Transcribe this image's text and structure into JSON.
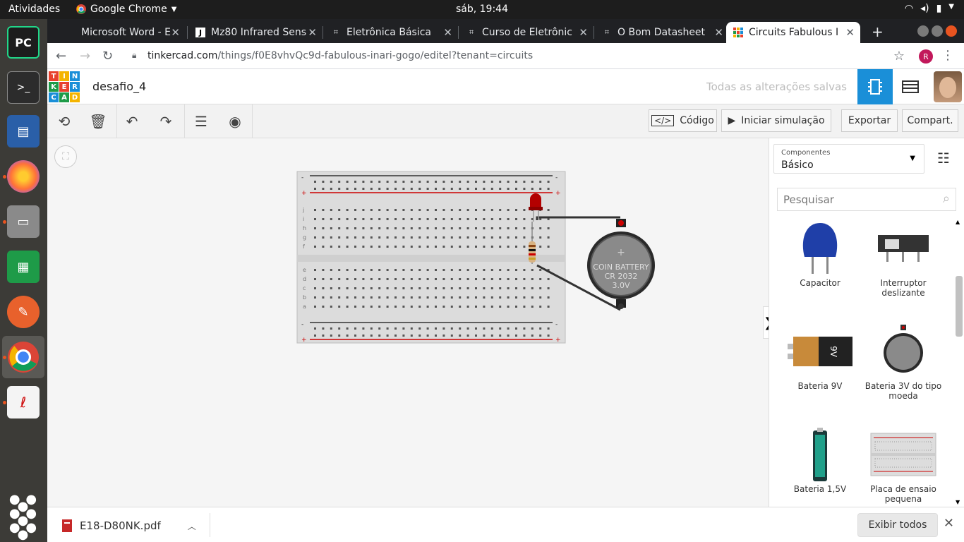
{
  "system": {
    "activities": "Atividades",
    "app_name": "Google Chrome",
    "clock": "sáb, 19:44"
  },
  "tabs": [
    {
      "label": "Microsoft Word - E"
    },
    {
      "label": "Mz80 Infrared Sens"
    },
    {
      "label": "Eletrônica Básica"
    },
    {
      "label": "Curso de Eletrônic"
    },
    {
      "label": "O Bom Datasheet"
    },
    {
      "label": "Circuits Fabulous I"
    }
  ],
  "address": {
    "domain": "tinkercad.com",
    "path": "/things/f0E8vhvQc9d-fabulous-inari-gogo/editel?tenant=circuits",
    "profile_initial": "R"
  },
  "tinkercad": {
    "logo_letters": [
      "T",
      "I",
      "N",
      "K",
      "E",
      "R",
      "C",
      "A",
      "D"
    ],
    "doc_name": "desafio_4",
    "save_status": "Todas as alterações salvas"
  },
  "toolbar": {
    "code_label": "Código",
    "sim_label": "Iniciar simulação",
    "export_label": "Exportar",
    "share_label": "Compart."
  },
  "panel": {
    "components_caption": "Componentes",
    "components_value": "Básico",
    "search_placeholder": "Pesquisar",
    "items": [
      {
        "label": "Capacitor"
      },
      {
        "label": "Interruptor deslizante"
      },
      {
        "label": "Bateria 9V"
      },
      {
        "label": "Bateria 3V do tipo moeda"
      },
      {
        "label": "Bateria 1,5V"
      },
      {
        "label": "Placa de ensaio pequena"
      }
    ]
  },
  "circuit": {
    "battery_text": [
      "COIN BATTERY",
      "CR 2032",
      "3.0V"
    ],
    "battery_plus": "+",
    "rows_top": [
      "j",
      "i",
      "h",
      "g",
      "f"
    ],
    "rows_bottom": [
      "e",
      "d",
      "c",
      "b",
      "a"
    ],
    "rail_minus": "-",
    "rail_plus": "+"
  },
  "download": {
    "filename": "E18-D80NK.pdf",
    "show_all": "Exibir todos"
  },
  "colors": {
    "chrome_dark": "#202124",
    "ubuntu_orange": "#e95420",
    "tinkercad_blue": "#1a8fd8"
  }
}
